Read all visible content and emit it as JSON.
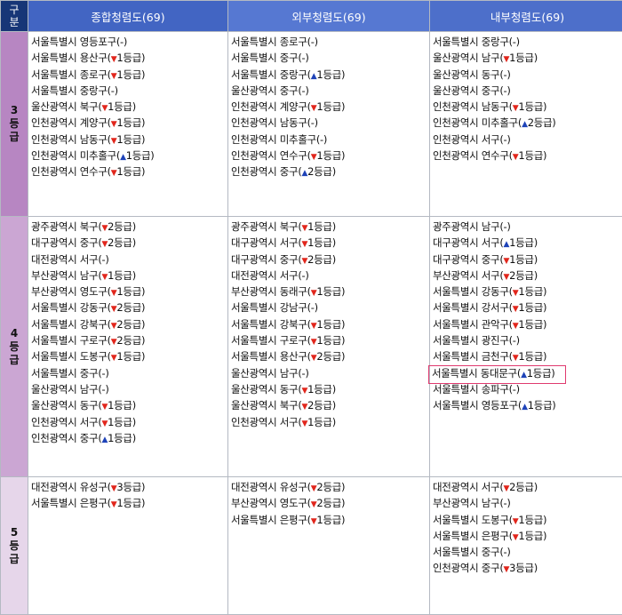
{
  "header": {
    "corner": [
      "구",
      "분"
    ],
    "columns": [
      "종합청렴도(69)",
      "외부청렴도(69)",
      "내부청렴도(69)"
    ]
  },
  "colors": {
    "corner": "#173677",
    "header": "#4a6cc8",
    "up": "#1e43b8",
    "down": "#e1261c",
    "highlight": "#e03a6f"
  },
  "rows": [
    {
      "grade": [
        "3",
        "등",
        "급"
      ],
      "cols": [
        [
          {
            "t": "서울특별시 영등포구(-)",
            "d": ""
          },
          {
            "t": "서울특별시 용산구(",
            "d": "down",
            "c": "1등급)"
          },
          {
            "t": "서울특별시 종로구(",
            "d": "down",
            "c": "1등급)"
          },
          {
            "t": "서울특별시 중랑구(-)",
            "d": ""
          },
          {
            "t": "울산광역시 북구(",
            "d": "down",
            "c": "1등급)"
          },
          {
            "t": "인천광역시 계양구(",
            "d": "down",
            "c": "1등급)"
          },
          {
            "t": "인천광역시 남동구(",
            "d": "down",
            "c": "1등급)"
          },
          {
            "t": "인천광역시 미추홀구(",
            "d": "up",
            "c": "1등급)"
          },
          {
            "t": "인천광역시 연수구(",
            "d": "down",
            "c": "1등급)"
          }
        ],
        [
          {
            "t": "서울특별시 종로구(-)",
            "d": ""
          },
          {
            "t": "서울특별시 중구(-)",
            "d": ""
          },
          {
            "t": "서울특별시 중랑구(",
            "d": "up",
            "c": "1등급)"
          },
          {
            "t": "울산광역시 중구(-)",
            "d": ""
          },
          {
            "t": "인천광역시 계양구(",
            "d": "down",
            "c": "1등급)"
          },
          {
            "t": "인천광역시 남동구(-)",
            "d": ""
          },
          {
            "t": "인천광역시 미추홀구(-)",
            "d": ""
          },
          {
            "t": "인천광역시 연수구(",
            "d": "down",
            "c": "1등급)"
          },
          {
            "t": "인천광역시 중구(",
            "d": "up",
            "c": "2등급)"
          }
        ],
        [
          {
            "t": "서울특별시 중랑구(-)",
            "d": ""
          },
          {
            "t": "울산광역시 남구(",
            "d": "down",
            "c": "1등급)"
          },
          {
            "t": "울산광역시 동구(-)",
            "d": ""
          },
          {
            "t": "울산광역시 중구(-)",
            "d": ""
          },
          {
            "t": "인천광역시 남동구(",
            "d": "down",
            "c": "1등급)"
          },
          {
            "t": "인천광역시 미추홀구(",
            "d": "up",
            "c": "2등급)"
          },
          {
            "t": "인천광역시 서구(-)",
            "d": ""
          },
          {
            "t": "인천광역시 연수구(",
            "d": "down",
            "c": "1등급)"
          }
        ]
      ]
    },
    {
      "grade": [
        "4",
        "등",
        "급"
      ],
      "cols": [
        [
          {
            "t": "광주광역시 북구(",
            "d": "down",
            "c": "2등급)"
          },
          {
            "t": "대구광역시 중구(",
            "d": "down",
            "c": "2등급)"
          },
          {
            "t": "대전광역시 서구(-)",
            "d": ""
          },
          {
            "t": "부산광역시 남구(",
            "d": "down",
            "c": "1등급)"
          },
          {
            "t": "부산광역시 영도구(",
            "d": "down",
            "c": "1등급)"
          },
          {
            "t": "서울특별시 강동구(",
            "d": "down",
            "c": "2등급)"
          },
          {
            "t": "서울특별시 강북구(",
            "d": "down",
            "c": "2등급)"
          },
          {
            "t": "서울특별시 구로구(",
            "d": "down",
            "c": "2등급)"
          },
          {
            "t": "서울특별시 도봉구(",
            "d": "down",
            "c": "1등급)"
          },
          {
            "t": "서울특별시 중구(-)",
            "d": ""
          },
          {
            "t": "울산광역시 남구(-)",
            "d": ""
          },
          {
            "t": "울산광역시 동구(",
            "d": "down",
            "c": "1등급)"
          },
          {
            "t": "인천광역시 서구(",
            "d": "down",
            "c": "1등급)"
          },
          {
            "t": "인천광역시 중구(",
            "d": "up",
            "c": "1등급)"
          }
        ],
        [
          {
            "t": "광주광역시 북구(",
            "d": "down",
            "c": "1등급)"
          },
          {
            "t": "대구광역시 서구(",
            "d": "down",
            "c": "1등급)"
          },
          {
            "t": "대구광역시 중구(",
            "d": "down",
            "c": "2등급)"
          },
          {
            "t": "대전광역시 서구(-)",
            "d": ""
          },
          {
            "t": "부산광역시 동래구(",
            "d": "down",
            "c": "1등급)"
          },
          {
            "t": "서울특별시 강남구(-)",
            "d": ""
          },
          {
            "t": "서울특별시 강북구(",
            "d": "down",
            "c": "1등급)"
          },
          {
            "t": "서울특별시 구로구(",
            "d": "down",
            "c": "1등급)"
          },
          {
            "t": "서울특별시 용산구(",
            "d": "down",
            "c": "2등급)"
          },
          {
            "t": "울산광역시 남구(-)",
            "d": ""
          },
          {
            "t": "울산광역시 동구(",
            "d": "down",
            "c": "1등급)"
          },
          {
            "t": "울산광역시 북구(",
            "d": "down",
            "c": "2등급)"
          },
          {
            "t": "인천광역시 서구(",
            "d": "down",
            "c": "1등급)"
          }
        ],
        [
          {
            "t": "광주광역시 남구(-)",
            "d": ""
          },
          {
            "t": "대구광역시 서구(",
            "d": "up",
            "c": "1등급)"
          },
          {
            "t": "대구광역시 중구(",
            "d": "down",
            "c": "1등급)"
          },
          {
            "t": "부산광역시 서구(",
            "d": "down",
            "c": "2등급)"
          },
          {
            "t": "서울특별시 강동구(",
            "d": "down",
            "c": "1등급)"
          },
          {
            "t": "서울특별시 강서구(",
            "d": "down",
            "c": "1등급)"
          },
          {
            "t": "서울특별시 관악구(",
            "d": "down",
            "c": "1등급)"
          },
          {
            "t": "서울특별시 광진구(-)",
            "d": ""
          },
          {
            "t": "서울특별시 금천구(",
            "d": "down",
            "c": "1등급)"
          },
          {
            "t": "서울특별시 동대문구(",
            "d": "up",
            "c": "1등급)",
            "hl": true
          },
          {
            "t": "서울특별시 송파구(-)",
            "d": ""
          },
          {
            "t": "서울특별시 영등포구(",
            "d": "up",
            "c": "1등급)"
          }
        ]
      ]
    },
    {
      "grade": [
        "5",
        "등",
        "급"
      ],
      "cols": [
        [
          {
            "t": "대전광역시 유성구(",
            "d": "down",
            "c": "3등급)"
          },
          {
            "t": "서울특별시 은평구(",
            "d": "down",
            "c": "1등급)"
          }
        ],
        [
          {
            "t": "대전광역시 유성구(",
            "d": "down",
            "c": "2등급)"
          },
          {
            "t": "부산광역시 영도구(",
            "d": "down",
            "c": "2등급)"
          },
          {
            "t": "서울특별시 은평구(",
            "d": "down",
            "c": "1등급)"
          }
        ],
        [
          {
            "t": "대전광역시 서구(",
            "d": "down",
            "c": "2등급)"
          },
          {
            "t": "부산광역시 남구(-)",
            "d": ""
          },
          {
            "t": "서울특별시 도봉구(",
            "d": "down",
            "c": "1등급)"
          },
          {
            "t": "서울특별시 은평구(",
            "d": "down",
            "c": "1등급)"
          },
          {
            "t": "서울특별시 중구(-)",
            "d": ""
          },
          {
            "t": "인천광역시 중구(",
            "d": "down",
            "c": "3등급)"
          }
        ]
      ]
    }
  ]
}
